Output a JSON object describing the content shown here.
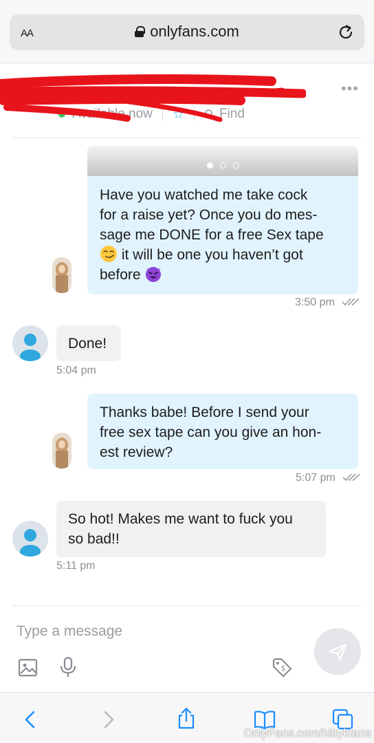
{
  "browser": {
    "text_size_label": "AA",
    "url": "onlyfans.com",
    "watermark": "OnlyFans.com/kittykfans"
  },
  "chat_header": {
    "name_fragment": "- - - - - -",
    "status": "Available now",
    "find_label": "Find",
    "status_color": "#3fc45a",
    "redaction_color": "#e8141b"
  },
  "messages": [
    {
      "direction": "outgoing",
      "sender": "creator",
      "has_media": true,
      "lines": [
        "Have you watched me take cock",
        "for a raise yet? Once you do mes-",
        "sage me DONE for a free Sex tape",
        "it will be one you haven’t got",
        "before"
      ],
      "emojis": [
        "smirking-face",
        "smiling-face-with-horns"
      ],
      "time": "3:50 pm"
    },
    {
      "direction": "incoming",
      "sender": "user",
      "lines": [
        "Done!"
      ],
      "time": "5:04 pm"
    },
    {
      "direction": "outgoing",
      "sender": "creator",
      "lines": [
        "Thanks babe! Before I send your",
        "free sex tape can you give an hon-",
        "est review?"
      ],
      "time": "5:07 pm"
    },
    {
      "direction": "incoming",
      "sender": "user",
      "lines": [
        "So hot! Makes me want to fuck you",
        "so bad!!"
      ],
      "time": "5:11 pm"
    }
  ],
  "composer": {
    "placeholder": "Type a message",
    "tools": [
      "image-icon",
      "microphone-icon",
      "price-tag-icon"
    ]
  },
  "colors": {
    "outgoing_bubble": "#e1f4fd",
    "incoming_bubble": "#f0f1f3",
    "accent": "#2fa8e0"
  }
}
